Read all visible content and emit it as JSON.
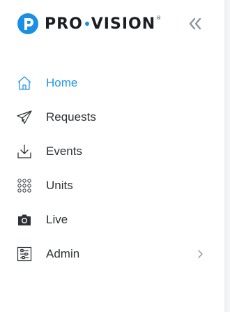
{
  "brand": {
    "name_left": "PRO",
    "name_right": "VISION",
    "registered": "®",
    "accent_color": "#1a8fe3"
  },
  "header": {
    "collapse_icon": "double-chevron-left-icon"
  },
  "menu": {
    "items": [
      {
        "label": "Home",
        "icon": "home-icon",
        "active": true
      },
      {
        "label": "Requests",
        "icon": "paper-plane-icon",
        "active": false
      },
      {
        "label": "Events",
        "icon": "download-icon",
        "active": false
      },
      {
        "label": "Units",
        "icon": "grid-dots-icon",
        "active": false
      },
      {
        "label": "Live",
        "icon": "camera-icon",
        "active": false
      },
      {
        "label": "Admin",
        "icon": "sliders-icon",
        "active": false,
        "has_submenu": true
      }
    ],
    "active_color": "#2196e8",
    "text_color": "#2d3036"
  }
}
